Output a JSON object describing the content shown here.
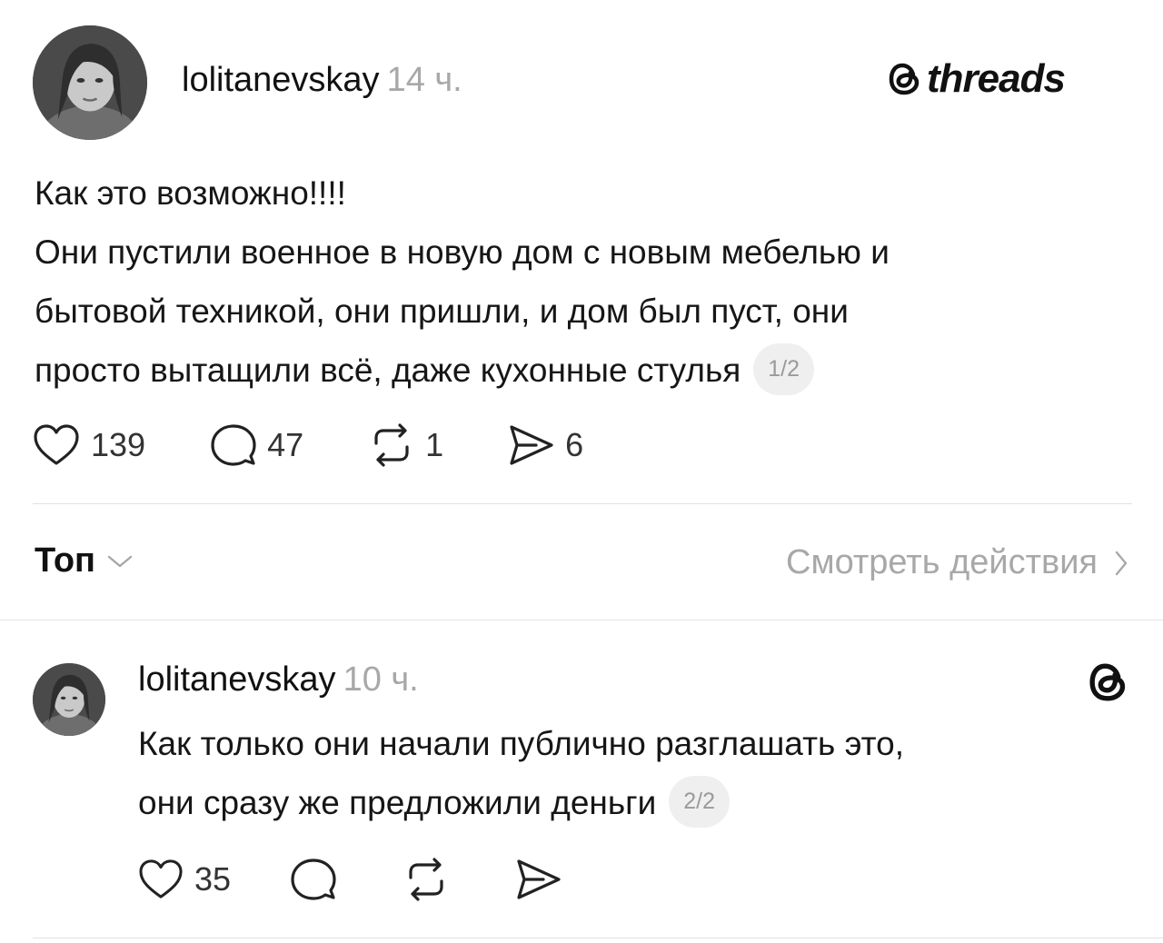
{
  "brand": {
    "name": "threads"
  },
  "post": {
    "username": "lolitanevskay",
    "time": "14 ч.",
    "lines": [
      "Как это возможно!!!!",
      "Они пустили военное в новую дом с новым мебелью и",
      "бытовой техникой, они пришли, и дом был пуст, они",
      "просто вытащили всё, даже кухонные стулья"
    ],
    "pager": "1/2",
    "likes": "139",
    "comments": "47",
    "reposts": "1",
    "shares": "6"
  },
  "filter": {
    "sort_label": "Топ",
    "activity_label": "Смотреть действия"
  },
  "reply": {
    "username": "lolitanevskay",
    "time": "10 ч.",
    "lines": [
      "Как только они начали публично разглашать это,",
      "они сразу же предложили деньги"
    ],
    "pager": "2/2",
    "likes": "35"
  },
  "icons": {
    "like": "heart-icon",
    "comment": "comment-bubble-icon",
    "repost": "repost-icon",
    "share": "send-icon",
    "brand": "threads-logo-icon"
  }
}
